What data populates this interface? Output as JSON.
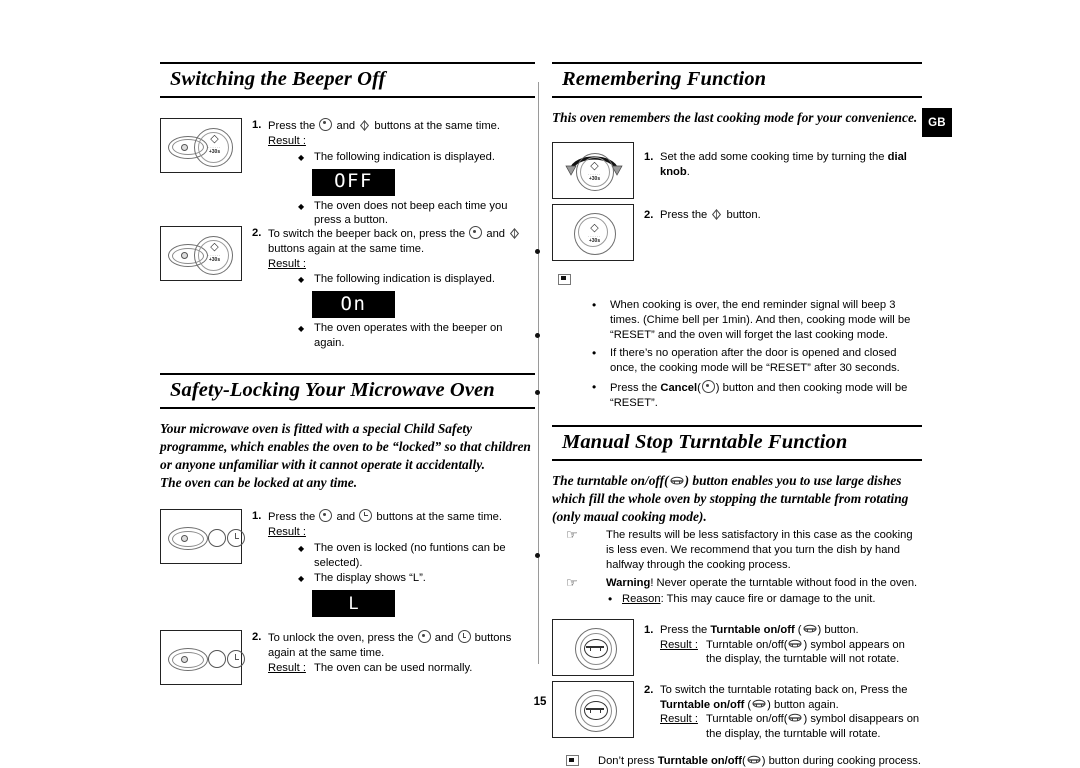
{
  "page": {
    "number": "15",
    "region_badge": "GB"
  },
  "sections": {
    "beeper": {
      "title": "Switching the Beeper Off",
      "steps": [
        {
          "num": "1.",
          "text_before": "Press the",
          "icon1": "cancel-button-icon",
          "text_mid": "and",
          "icon2": "start-button-icon",
          "text_after": "buttons at the same time.",
          "result_label": "Result :",
          "bullets": [
            "The following indication is displayed.",
            "The oven does not beep each time you press a button."
          ],
          "display": "OFF"
        },
        {
          "num": "2.",
          "text_before": "To switch the beeper back on, press the",
          "icon1": "cancel-button-icon",
          "text_mid": "and",
          "icon2": "start-button-icon",
          "text_after": "buttons again at the same time.",
          "result_label": "Result :",
          "bullets": [
            "The following indication is displayed.",
            "The oven operates with the beeper on again."
          ],
          "display": "On"
        }
      ]
    },
    "safety_lock": {
      "title": "Safety-Locking Your Microwave Oven",
      "intro": "Your microwave oven is fitted with a special Child Safety programme, which enables the oven to be “locked” so that children or anyone unfamiliar with it cannot operate it accidentally.",
      "intro2": "The oven can be locked at any time.",
      "steps": [
        {
          "num": "1.",
          "text_before": "Press the",
          "icon1": "cancel-button-icon",
          "text_mid": "and",
          "icon2": "clock-button-icon",
          "text_after": "buttons at the same time.",
          "result_label": "Result :",
          "bullets": [
            "The oven is locked (no funtions can be selected).",
            "The display shows “L”."
          ],
          "display": "L"
        },
        {
          "num": "2.",
          "text_before": "To unlock the oven, press the",
          "icon1": "cancel-button-icon",
          "text_mid": "and",
          "icon2": "clock-button-icon",
          "text_after": "buttons again at the same time.",
          "result_label": "Result :",
          "result_value": "The oven can be used normally."
        }
      ]
    },
    "remembering": {
      "title": "Remembering Function",
      "intro": "This oven remembers the last cooking mode for your convenience.",
      "steps": [
        {
          "num": "1.",
          "text_before": "Set the add some cooking time by turning the",
          "bold": "dial knob",
          "text_after": "."
        },
        {
          "num": "2.",
          "text_before": "Press the",
          "icon1": "start-button-icon",
          "text_after": "button."
        }
      ],
      "notes": [
        "When cooking is over, the end reminder signal will beep 3 times. (Chime bell per 1min). And then, cooking mode will be “RESET” and the oven will forget the last cooking mode.",
        "If there’s no operation after the door is opened and closed once, the cooking mode will be “RESET” after 30 seconds."
      ],
      "note_cancel": {
        "before": "Press the",
        "bold": "Cancel",
        "icon": "cancel-button-icon",
        "after": ") button and then cooking mode will be “RESET”."
      }
    },
    "turntable": {
      "title": "Manual Stop Turntable Function",
      "intro_before": "The turntable on/off(",
      "intro_icon": "turntable-icon",
      "intro_after": ") button enables you to use large dishes which fill the whole oven by stopping the turntable from rotating (only maual cooking mode).",
      "hand_notes": [
        {
          "text": "The results will be less satisfactory in this case as the cooking is less even. We recommend that you turn the dish by hand halfway through the cooking process."
        }
      ],
      "warning": {
        "bold": "Warning",
        "text": "! Never operate the turntable without food in the oven.",
        "reason_label": "Reason",
        "reason_text": ": This may cauce fire or damage to the unit."
      },
      "steps": [
        {
          "num": "1.",
          "text_before": "Press the",
          "bold": "Turntable on/off",
          "icon": "turntable-icon",
          "text_after": ") button.",
          "result_label": "Result :",
          "result_value": "Turntable on/off(",
          "result_value2": ") symbol appears on the display, the turntable will not rotate."
        },
        {
          "num": "2.",
          "text_before": "To switch the turntable rotating back on, Press the",
          "bold": "Turntable on/off",
          "icon": "turntable-icon",
          "text_after": ") button again.",
          "result_label": "Result :",
          "result_value": "Turntable on/off(",
          "result_value2": ") symbol disappears on the display, the turntable will rotate."
        }
      ],
      "footnote": {
        "before": "Don’t press",
        "bold": "Turntable on/off",
        "icon": "turntable-icon",
        "after": ") button during cooking process."
      }
    }
  },
  "panel_art": {
    "start_label": "+30s",
    "start_ticks": "······"
  }
}
